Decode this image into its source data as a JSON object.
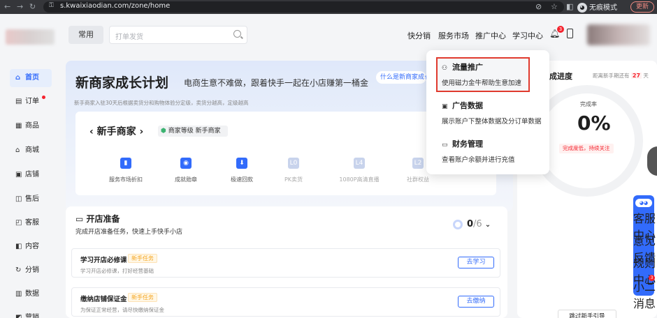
{
  "browser": {
    "url": "s.kwaixiaodian.com/zone/home",
    "incognito_label": "无痕模式",
    "update_label": "更新"
  },
  "header": {
    "common_label": "常用",
    "search_placeholder": "打单发货",
    "nav": [
      "快分销",
      "服务市场",
      "推广中心",
      "学习中心"
    ],
    "bell_badge": "3"
  },
  "sidebar": {
    "items": [
      {
        "label": "首页",
        "icon": "home-icon",
        "glyph": "⌂",
        "active": true
      },
      {
        "label": "订单",
        "icon": "order-icon",
        "glyph": "▤",
        "active": false
      },
      {
        "label": "商品",
        "icon": "product-icon",
        "glyph": "▦",
        "active": false
      },
      {
        "label": "商城",
        "icon": "mall-icon",
        "glyph": "⌂",
        "active": false
      },
      {
        "label": "店铺",
        "icon": "store-icon",
        "glyph": "▣",
        "active": false
      },
      {
        "label": "售后",
        "icon": "after-sale-icon",
        "glyph": "◫",
        "active": false
      },
      {
        "label": "客服",
        "icon": "service-icon",
        "glyph": "◰",
        "active": false
      },
      {
        "label": "内容",
        "icon": "content-icon",
        "glyph": "◧",
        "active": false
      },
      {
        "label": "分销",
        "icon": "distribution-icon",
        "glyph": "↻",
        "active": false
      },
      {
        "label": "数据",
        "icon": "data-icon",
        "glyph": "▥",
        "active": false
      },
      {
        "label": "营销",
        "icon": "marketing-icon",
        "glyph": "◩",
        "active": false
      }
    ]
  },
  "banner": {
    "title": "新商家成长计划",
    "subtitle": "电商生意不难做，跟着快手一起在小店赚第一桶金",
    "what_link": "什么是新商家成长",
    "note": "新手商家入驻30天后根据卖货分和购物体验分定级，卖货分越高，定级越高"
  },
  "new_merchant": {
    "title": "新手商家",
    "level_label": "商家等级 新手商家",
    "perks": [
      {
        "label": "服务市场折扣",
        "glyph": "▮",
        "enabled": true
      },
      {
        "label": "成就勋章",
        "glyph": "◉",
        "enabled": true
      },
      {
        "label": "极速回款",
        "glyph": "⬇",
        "enabled": true
      },
      {
        "label": "PK卖货",
        "glyph": "L0",
        "enabled": false
      },
      {
        "label": "1080P高清直播",
        "glyph": "L4",
        "enabled": false
      },
      {
        "label": "社群权益",
        "glyph": "L2",
        "enabled": false
      }
    ]
  },
  "shop_prep": {
    "title": "开店准备",
    "subtitle": "完成开店准备任务，快速上手快手小店",
    "progress_done": "0",
    "progress_total": "/6",
    "tasks": [
      {
        "title": "学习开店必修课",
        "tag": "新手任务",
        "desc": "学习开店必修课，打好经营基础",
        "button": "去学习"
      },
      {
        "title": "缴纳店铺保证金",
        "tag": "新手任务",
        "desc": "为保证正常经营，请尽快缴纳保证金",
        "button": "去缴纳"
      }
    ]
  },
  "progress_panel": {
    "title": "成进度",
    "days_prefix": "距离新手期还有",
    "days": "27",
    "days_suffix": "天",
    "rate_label": "完成率",
    "rate_value": "0%",
    "warning": "完成度低，持续关注",
    "skip_label": "跳过新手引导"
  },
  "float_bar": {
    "items": [
      "客服中心",
      "意见反馈",
      "规则中心",
      "小二消息"
    ],
    "badge": "3"
  },
  "dropdown": {
    "items": [
      {
        "title": "流量推广",
        "desc": "使用磁力金牛帮助生意加速",
        "icon": "traffic-icon",
        "glyph": "⚇"
      },
      {
        "title": "广告数据",
        "desc": "展示账户下整体数据及分订单数据",
        "icon": "ad-data-icon",
        "glyph": "▣"
      },
      {
        "title": "财务管理",
        "desc": "查看账户余额并进行充值",
        "icon": "finance-icon",
        "glyph": "▭"
      }
    ]
  }
}
